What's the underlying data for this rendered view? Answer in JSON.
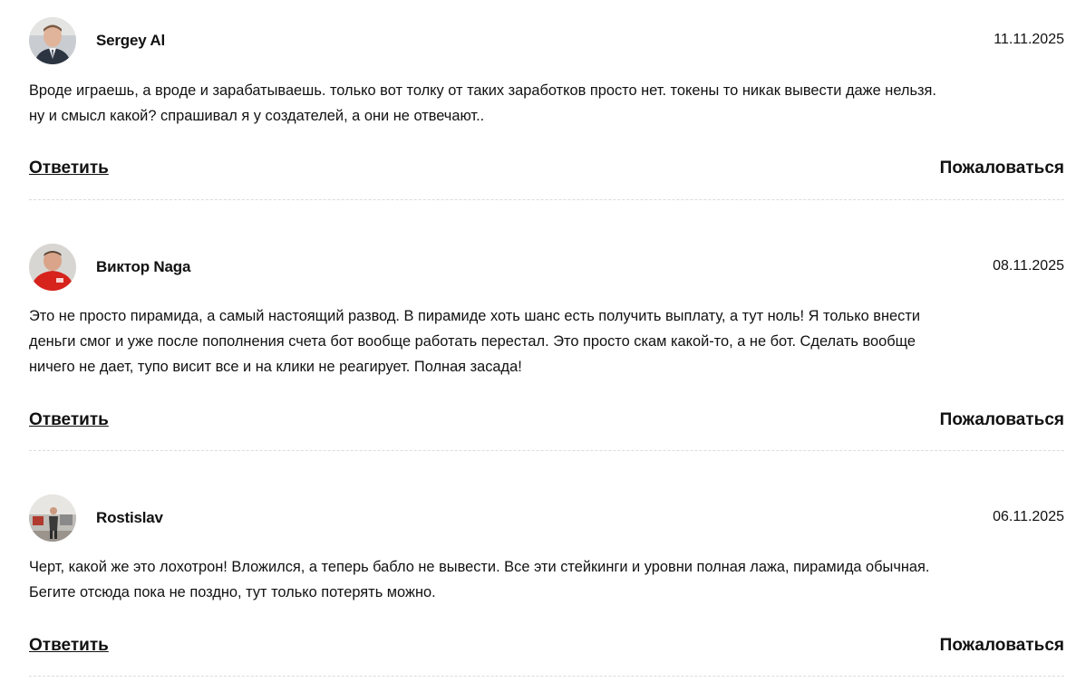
{
  "comments": [
    {
      "author": "Sergey Al",
      "date": "11.11.2025",
      "avatar": "avatar-man-in-suit",
      "text": "Вроде играешь, а вроде и зарабатываешь. только вот толку от таких заработков просто нет. токены то никак вывести даже нельзя.\nну и смысл какой? спрашивал я у создателей, а они не отвечают..",
      "reply_label": "Ответить",
      "report_label": "Пожаловаться"
    },
    {
      "author": "Виктор Naga",
      "date": "08.11.2025",
      "avatar": "avatar-man-red-shirt",
      "text": "Это не просто пирамида, а самый настоящий развод. В пирамиде хоть шанс есть получить выплату, а тут ноль! Я только внести\nденьги смог и уже после пополнения счета бот вообще работать перестал. Это просто скам какой-то, а не бот. Сделать вообще\nничего не дает, тупо висит все и на клики не реагирует. Полная засада!",
      "reply_label": "Ответить",
      "report_label": "Пожаловаться"
    },
    {
      "author": "Rostislav",
      "date": "06.11.2025",
      "avatar": "avatar-man-in-room",
      "text": "Черт, какой же это лохотрон! Вложился, а теперь бабло не вывести. Все эти стейкинги и уровни полная лажа, пирамида обычная.\nБегите отсюда пока не поздно, тут только потерять можно.",
      "reply_label": "Ответить",
      "report_label": "Пожаловаться"
    }
  ],
  "colors": {
    "text": "#111111",
    "divider": "#dcdcdc",
    "background": "#ffffff"
  }
}
